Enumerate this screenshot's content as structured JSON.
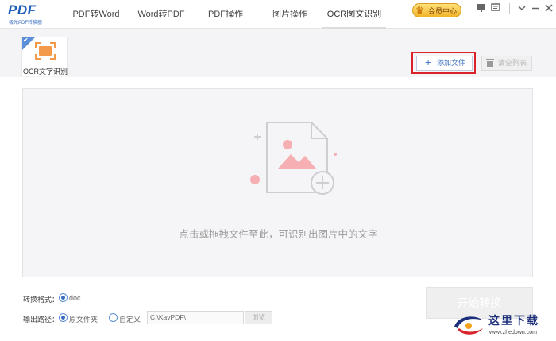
{
  "app": {
    "logo_text": "PDF",
    "logo_sub": "极光PDF转换器"
  },
  "nav": {
    "tabs": [
      {
        "label": "PDF转Word"
      },
      {
        "label": "Word转PDF"
      },
      {
        "label": "PDF操作"
      },
      {
        "label": "图片操作"
      },
      {
        "label": "OCR图文识别"
      }
    ],
    "active_tab": "OCR图文识别"
  },
  "header": {
    "vip_label": "会员中心",
    "vip_badge": "VIP"
  },
  "toolbar": {
    "ocr_card_label": "OCR文字识别",
    "add_file_label": "添加文件",
    "clear_list_label": "清空列表"
  },
  "dropzone": {
    "hint": "点击或拖拽文件至此，可识别出图片中的文字"
  },
  "form": {
    "format_label": "转换格式：",
    "format_option": "doc",
    "output_label": "输出路径：",
    "output_original": "原文件夹",
    "output_custom": "自定义",
    "output_path": "C:\\KavPDF\\",
    "browse_label": "浏览"
  },
  "actions": {
    "start_label": "开始转换"
  },
  "watermark": {
    "title": "这里下载",
    "url": "www.zhedown.com"
  },
  "colors": {
    "accent": "#3a6fc0",
    "highlight_border": "#d8232a",
    "ocr_orange": "#f39a4a",
    "art_pink": "#f6b0b4"
  }
}
